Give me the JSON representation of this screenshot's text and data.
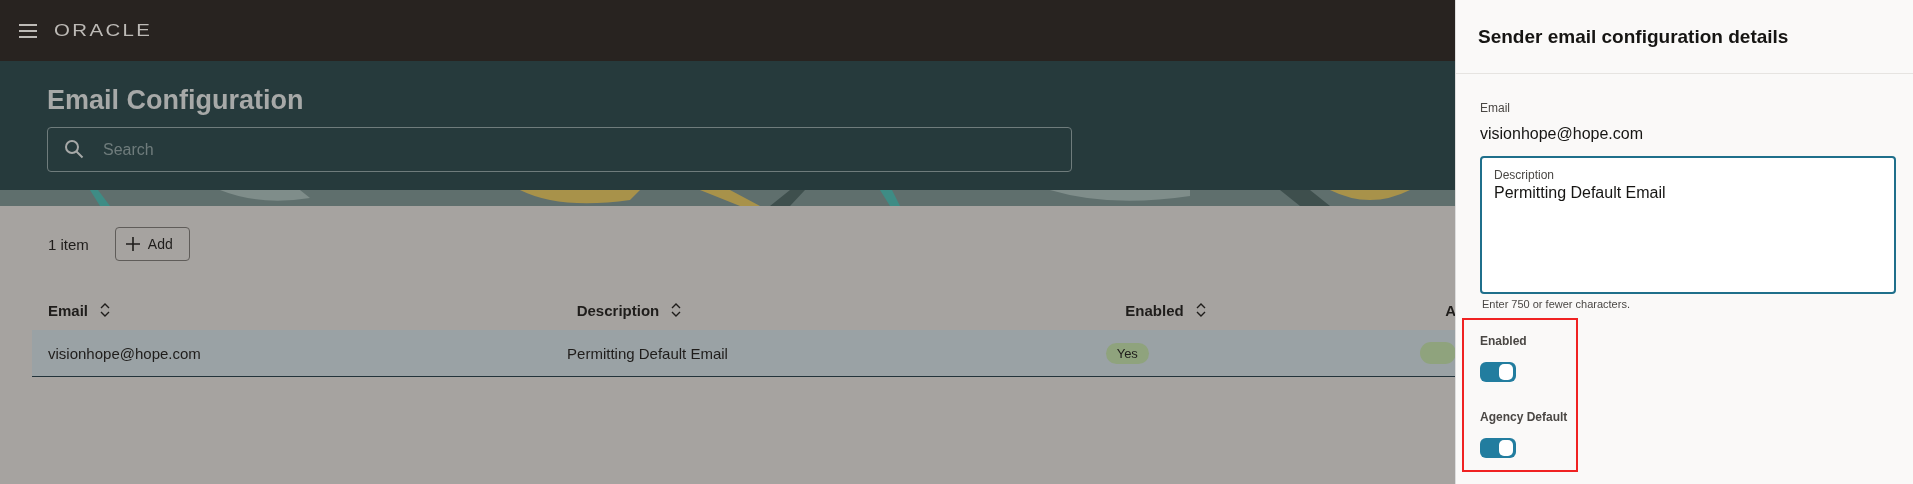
{
  "header": {
    "logo": "ORACLE"
  },
  "page": {
    "title": "Email Configuration",
    "search": {
      "placeholder": "Search"
    }
  },
  "toolbar": {
    "count": "1 item",
    "add_button": "Add"
  },
  "table": {
    "columns": [
      {
        "label": "Email",
        "sortable": true
      },
      {
        "label": "Description",
        "sortable": true
      },
      {
        "label": "Enabled",
        "sortable": true
      },
      {
        "label": "A",
        "sortable": false
      }
    ],
    "rows": [
      {
        "email": "visionhope@hope.com",
        "description": "Permitting Default Email",
        "enabled": "Yes",
        "selected": true
      }
    ]
  },
  "panel": {
    "title": "Sender email configuration details",
    "email_label": "Email",
    "email_value": "visionhope@hope.com",
    "description": {
      "label": "Description",
      "value": "Permitting Default Email",
      "hint": "Enter 750 or fewer characters."
    },
    "toggles": [
      {
        "label": "Enabled",
        "on": true
      },
      {
        "label": "Agency Default",
        "on": true
      }
    ]
  }
}
